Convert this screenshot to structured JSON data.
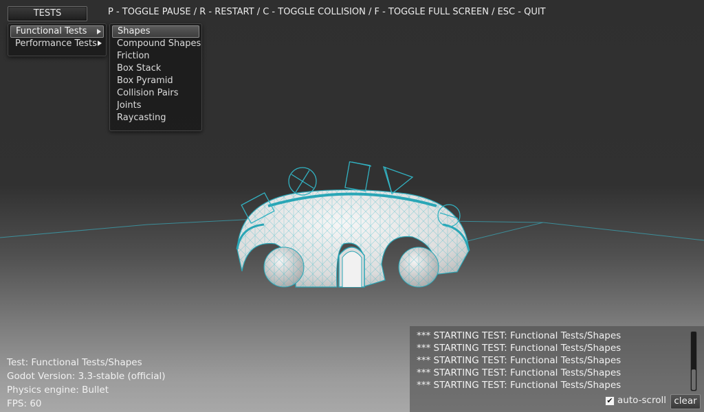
{
  "toolbar": {
    "tests_label": "TESTS",
    "hotkeys": "P - TOGGLE PAUSE / R - RESTART / C - TOGGLE COLLISION / F - TOGGLE FULL SCREEN / ESC - QUIT"
  },
  "menu": {
    "categories": [
      "Functional Tests",
      "Performance Tests"
    ],
    "submenu": [
      "Shapes",
      "Compound Shapes",
      "Friction",
      "Box Stack",
      "Box Pyramid",
      "Collision Pairs",
      "Joints",
      "Raycasting"
    ]
  },
  "info": {
    "test": "Test: Functional Tests/Shapes",
    "godot_version": "Godot Version: 3.3-stable (official)",
    "physics_engine": "Physics engine: Bullet",
    "fps": "FPS: 60"
  },
  "log": {
    "lines": [
      "*** STARTING TEST: Functional Tests/Shapes",
      "*** STARTING TEST: Functional Tests/Shapes",
      "*** STARTING TEST: Functional Tests/Shapes",
      "*** STARTING TEST: Functional Tests/Shapes",
      "*** STARTING TEST: Functional Tests/Shapes"
    ],
    "autoscroll_label": "auto-scroll",
    "autoscroll_checked": true,
    "clear_label": "clear"
  },
  "colors": {
    "wire": "#2fb4c4",
    "dome": "#e9e9e9"
  }
}
